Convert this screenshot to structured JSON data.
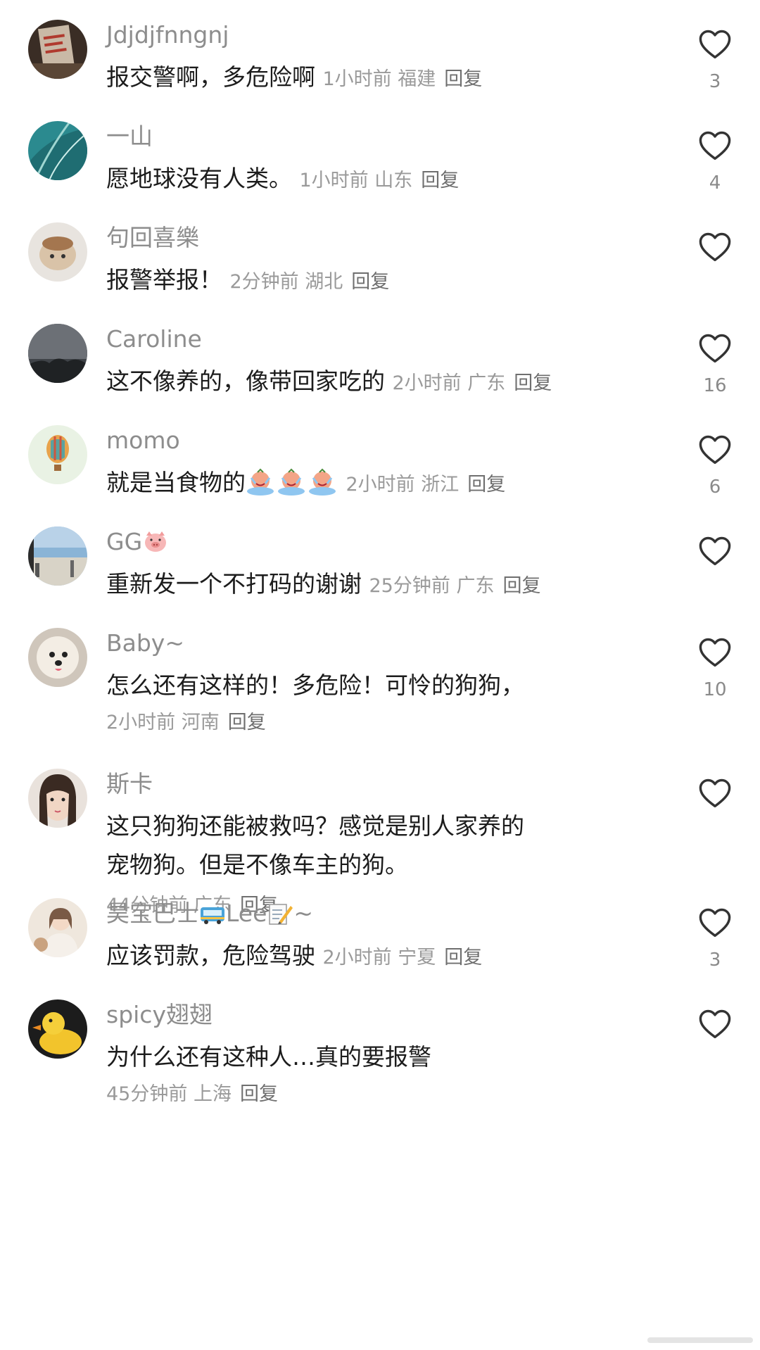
{
  "comments": [
    {
      "user": "Jdjdjfnngnj",
      "text": "报交警啊，多危险啊",
      "time": "1小时前",
      "region": "福建",
      "reply": "回复",
      "likes": "3"
    },
    {
      "user": "一山",
      "text": "愿地球没有人类。",
      "time": "1小时前",
      "region": "山东",
      "reply": "回复",
      "likes": "4"
    },
    {
      "user": "句回喜樂",
      "text": "报警举报！",
      "time": "2分钟前",
      "region": "湖北",
      "reply": "回复",
      "likes": ""
    },
    {
      "user": "Caroline",
      "text": "这不像养的，像带回家吃的",
      "time": "2小时前",
      "region": "广东",
      "reply": "回复",
      "likes": "16"
    },
    {
      "user": "momo",
      "text": "就是当食物的",
      "time": "2小时前",
      "region": "浙江",
      "reply": "回复",
      "likes": "6"
    },
    {
      "user": "GG",
      "text": "重新发一个不打码的谢谢",
      "time": "25分钟前",
      "region": "广东",
      "reply": "回复",
      "likes": ""
    },
    {
      "user": "Baby~",
      "text": "怎么还有这样的！多危险！可怜的狗狗，",
      "time": "2小时前",
      "region": "河南",
      "reply": "回复",
      "likes": "10"
    },
    {
      "user": "斯卡",
      "text": "这只狗狗还能被救吗？感觉是别人家养的宠物狗。但是不像车主的狗。",
      "time": "44分钟前",
      "region": "广东",
      "reply": "回复",
      "likes": ""
    },
    {
      "user_a": "昊宝巴士",
      "user_b": "Lee",
      "user_c": "~",
      "text": "应该罚款，危险驾驶",
      "time": "2小时前",
      "region": "宁夏",
      "reply": "回复",
      "likes": "3"
    },
    {
      "user": "spicy翅翅",
      "text": "为什么还有这种人…真的要报警",
      "time": "45分钟前",
      "region": "上海",
      "reply": "回复",
      "likes": ""
    }
  ],
  "icons": {
    "like": "heart-outline-icon",
    "crying_emoji": "crying-face-emoji",
    "pig_emoji": "pig-face-emoji",
    "bus_emoji": "bus-emoji",
    "memo_emoji": "memo-emoji"
  },
  "colors": {
    "username": "#8d8d8d",
    "text": "#1c1c1c",
    "meta": "#9a9a9a",
    "reply": "#6f6f6f",
    "heart": "#333333"
  }
}
